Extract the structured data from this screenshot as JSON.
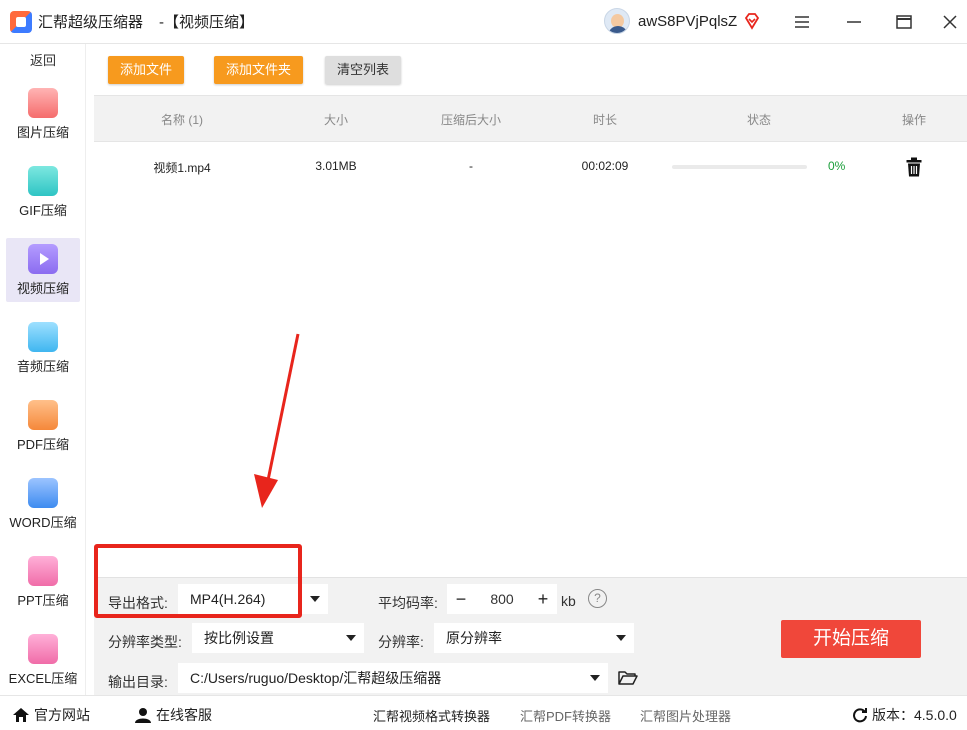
{
  "titlebar": {
    "app_name": "汇帮超级压缩器",
    "page_title": "-【视频压缩】",
    "username": "awS8PVjPqlsZ"
  },
  "sidebar": {
    "back": "返回",
    "items": [
      {
        "label": "图片压缩",
        "icon": "image-icon",
        "color": "#f56c6c"
      },
      {
        "label": "GIF压缩",
        "icon": "gif-icon",
        "color": "#2ec4c4"
      },
      {
        "label": "视频压缩",
        "icon": "video-icon",
        "color": "#8b6cf0"
      },
      {
        "label": "音频压缩",
        "icon": "audio-icon",
        "color": "#3fb6f0"
      },
      {
        "label": "PDF压缩",
        "icon": "pdf-icon",
        "color": "#f5883a"
      },
      {
        "label": "WORD压缩",
        "icon": "word-icon",
        "color": "#3d8bf0"
      },
      {
        "label": "PPT压缩",
        "icon": "ppt-icon",
        "color": "#f06ca8"
      },
      {
        "label": "EXCEL压缩",
        "icon": "excel-icon",
        "color": "#f06ca8"
      }
    ]
  },
  "toolbar": {
    "add_file": "添加文件",
    "add_folder": "添加文件夹",
    "clear_list": "清空列表"
  },
  "table": {
    "headers": [
      "名称 (1)",
      "大小",
      "压缩后大小",
      "时长",
      "状态",
      "操作"
    ],
    "rows": [
      {
        "name": "视频1.mp4",
        "size": "3.01MB",
        "compressed": "-",
        "duration": "00:02:09",
        "progress": 0,
        "percent": "0%"
      }
    ]
  },
  "settings": {
    "format_label": "导出格式:",
    "format_value": "MP4(H.264)",
    "bitrate_label": "平均码率:",
    "bitrate_value": "800",
    "bitrate_unit": "kb",
    "res_type_label": "分辨率类型:",
    "res_type_value": "按比例设置",
    "res_label": "分辨率:",
    "res_value": "原分辨率",
    "output_label": "输出目录:",
    "output_value": "C:/Users/ruguo/Desktop/汇帮超级压缩器",
    "start": "开始压缩"
  },
  "footer": {
    "website": "官方网站",
    "support": "在线客服",
    "links": [
      "汇帮视频格式转换器",
      "汇帮PDF转换器",
      "汇帮图片处理器"
    ],
    "version": "版本：4.5.0.0"
  },
  "colors": {
    "accent": "#f79a1e",
    "start": "#f0473a",
    "highlight": "#e8251c"
  }
}
